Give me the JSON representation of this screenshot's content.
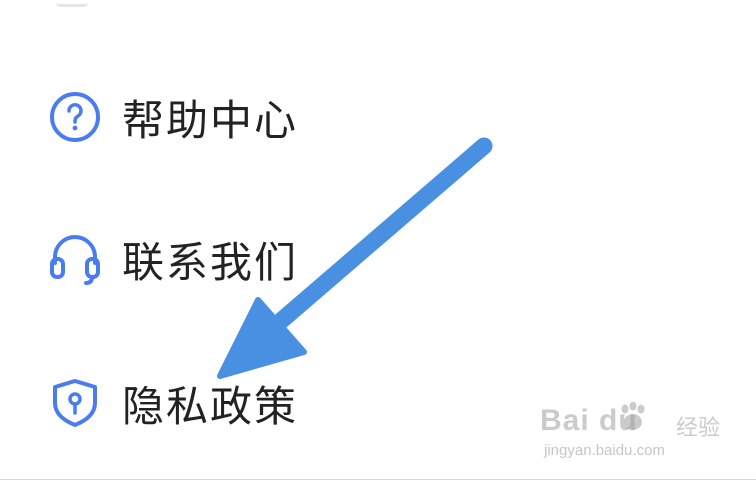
{
  "menu": {
    "items": [
      {
        "label": "帮助中心",
        "icon": "help-circle-icon"
      },
      {
        "label": "联系我们",
        "icon": "headset-icon"
      },
      {
        "label": "隐私政策",
        "icon": "shield-keyhole-icon"
      }
    ]
  },
  "annotation": {
    "icon": "pointer-arrow",
    "color": "#4a90e2"
  },
  "watermark": {
    "brand": "Bai du",
    "brand_cn": "经验",
    "domain": "jingyan.baidu.com"
  },
  "colors": {
    "icon": "#4a7cf0",
    "text": "#222222"
  }
}
